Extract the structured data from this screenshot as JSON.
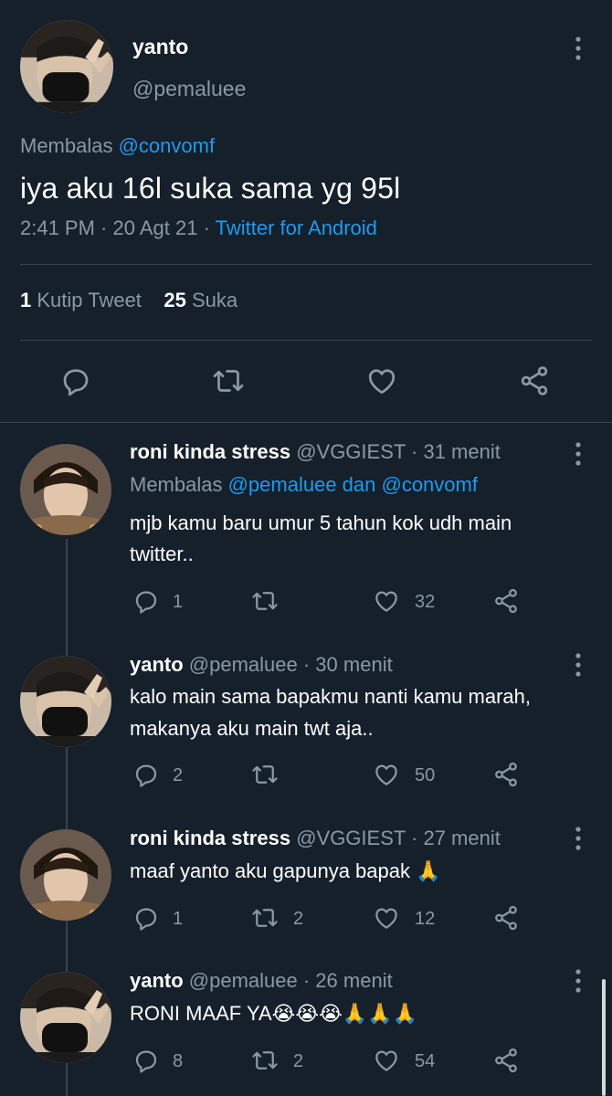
{
  "main_tweet": {
    "name": "yanto",
    "handle": "@pemaluee",
    "reply_prefix": "Membalas ",
    "reply_to": "@convomf",
    "text": "iya aku 16l suka sama yg 95l",
    "time": "2:41 PM · 20 Agt 21 · ",
    "source": "Twitter for Android",
    "quote_count": "1",
    "quote_label": " Kutip Tweet",
    "like_count": "25",
    "like_label": " Suka",
    "actions": [
      "reply-icon",
      "retweet-icon",
      "like-icon",
      "share-icon"
    ]
  },
  "replies": [
    {
      "name": "roni kinda stress",
      "meta": " @VGGIEST · 31 menit",
      "reply_prefix": "Membalas ",
      "reply_to": "@pemaluee dan @convomf",
      "line1": "mjb kamu baru umur 5 tahun kok udh main",
      "line2": "twitter..",
      "replies": "1",
      "retweets": "",
      "likes": "32"
    },
    {
      "name": "yanto",
      "meta": " @pemaluee · 30 menit",
      "line1": "kalo main sama bapakmu nanti kamu marah,",
      "line2": "makanya aku main twt aja..",
      "replies": "2",
      "retweets": "",
      "likes": "50"
    },
    {
      "name": "roni kinda stress",
      "meta": " @VGGIEST · 27 menit",
      "line1": "maaf yanto aku gapunya bapak 🙏",
      "replies": "1",
      "retweets": "2",
      "likes": "12"
    },
    {
      "name": "yanto",
      "meta": " @pemaluee · 26 menit",
      "line1": "RONI MAAF YA😭😭😭🙏🙏🙏",
      "replies": "8",
      "retweets": "2",
      "likes": "54"
    }
  ]
}
